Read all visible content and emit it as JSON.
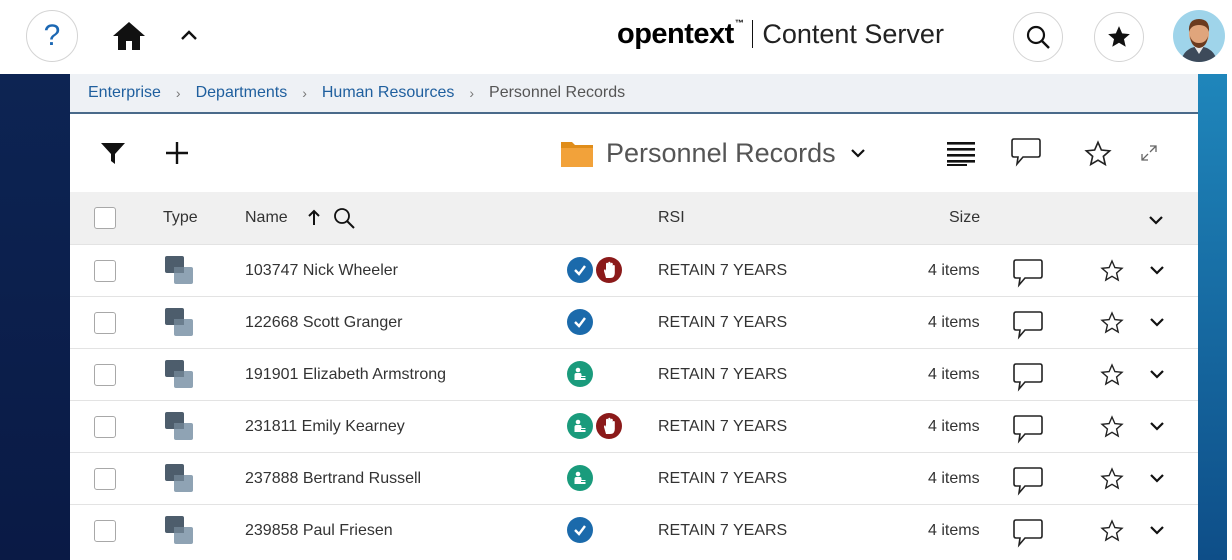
{
  "header": {
    "brand_logo": "opentext",
    "brand_tm": "™",
    "brand_product": "Content Server",
    "help_glyph": "?"
  },
  "breadcrumb": {
    "items": [
      "Enterprise",
      "Departments",
      "Human Resources"
    ],
    "current": "Personnel Records"
  },
  "toolbar": {
    "title": "Personnel Records"
  },
  "table": {
    "columns": {
      "type": "Type",
      "name": "Name",
      "rsi": "RSI",
      "size": "Size"
    },
    "rows": [
      {
        "name": "103747 Nick Wheeler",
        "status": [
          "checked",
          "hold"
        ],
        "rsi": "RETAIN 7 YEARS",
        "size": "4 items"
      },
      {
        "name": "122668 Scott Granger",
        "status": [
          "checked"
        ],
        "rsi": "RETAIN 7 YEARS",
        "size": "4 items"
      },
      {
        "name": "191901 Elizabeth Armstrong",
        "status": [
          "reserved"
        ],
        "rsi": "RETAIN 7 YEARS",
        "size": "4 items"
      },
      {
        "name": "231811 Emily Kearney",
        "status": [
          "reserved",
          "hold"
        ],
        "rsi": "RETAIN 7 YEARS",
        "size": "4 items"
      },
      {
        "name": "237888 Bertrand Russell",
        "status": [
          "reserved"
        ],
        "rsi": "RETAIN 7 YEARS",
        "size": "4 items"
      },
      {
        "name": "239858 Paul Friesen",
        "status": [
          "checked"
        ],
        "rsi": "RETAIN 7 YEARS",
        "size": "4 items"
      }
    ]
  },
  "icons": {
    "help": "help-icon",
    "home": "home-icon",
    "collapse": "chevron-up-icon",
    "search": "search-icon",
    "favorites": "star-filled-icon",
    "filter": "filter-icon",
    "add": "plus-icon",
    "folder": "folder-icon",
    "description": "description-lines-icon",
    "comments": "comment-icon",
    "star": "star-outline-icon",
    "expand": "expand-icon"
  },
  "colors": {
    "link": "#1f5f9e",
    "check": "#1b6aab",
    "hold": "#8b1a1a",
    "reserved": "#1a9b7c",
    "folder": "#f2a23a",
    "left_band": "#0d2453",
    "right_band": "#1f86bb"
  }
}
